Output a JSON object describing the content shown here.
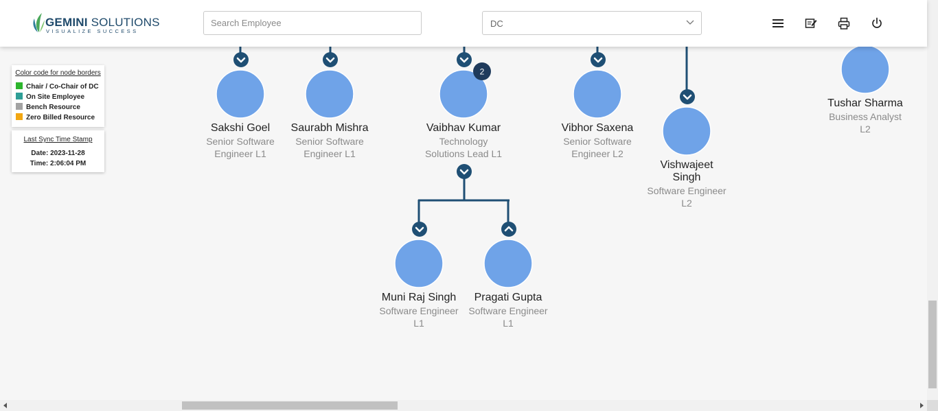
{
  "header": {
    "logo_main_bold": "GEMINI",
    "logo_main": " SOLUTIONS",
    "logo_tagline": "VISUALIZE SUCCESS",
    "search_placeholder": "Search Employee",
    "dc_value": "DC",
    "icons": [
      "menu-icon",
      "notes-icon",
      "print-icon",
      "power-icon"
    ]
  },
  "legend": {
    "title": "Color code for node borders",
    "items": [
      {
        "label": "Chair / Co-Chair of DC",
        "color": "#2db52d"
      },
      {
        "label": "On Site Employee",
        "color": "#2e9e96"
      },
      {
        "label": "Bench Resource",
        "color": "#a3a3a3"
      },
      {
        "label": "Zero Billed Resource",
        "color": "#f2a712"
      }
    ]
  },
  "sync": {
    "title": "Last Sync Time Stamp",
    "date": "Date: 2023-11-28",
    "time": "Time: 2:06:04 PM"
  },
  "nodes": [
    {
      "name": "Sakshi Goel",
      "title_lines": [
        "Senior Software",
        "Engineer L1"
      ]
    },
    {
      "name": "Saurabh Mishra",
      "title_lines": [
        "Senior Software",
        "Engineer L1"
      ]
    },
    {
      "name": "Vaibhav Kumar",
      "title_lines": [
        "Technology",
        "Solutions Lead L1"
      ],
      "badge": "2"
    },
    {
      "name": "Vibhor Saxena",
      "title_lines": [
        "Senior Software",
        "Engineer L2"
      ]
    },
    {
      "name_lines": [
        "Vishwajeet",
        "Singh"
      ],
      "title_lines": [
        "Software Engineer",
        "L2"
      ]
    },
    {
      "name": "Tushar Sharma",
      "title_lines": [
        "Business Analyst",
        "L2"
      ]
    },
    {
      "name": "Muni Raj Singh",
      "title_lines": [
        "Software Engineer",
        "L1"
      ]
    },
    {
      "name": "Pragati Gupta",
      "title_lines": [
        "Software Engineer",
        "L1"
      ]
    }
  ],
  "colors": {
    "node_fill": "#6fa3e8",
    "connector": "#1f4f74",
    "badge": "#1f3b5c"
  }
}
